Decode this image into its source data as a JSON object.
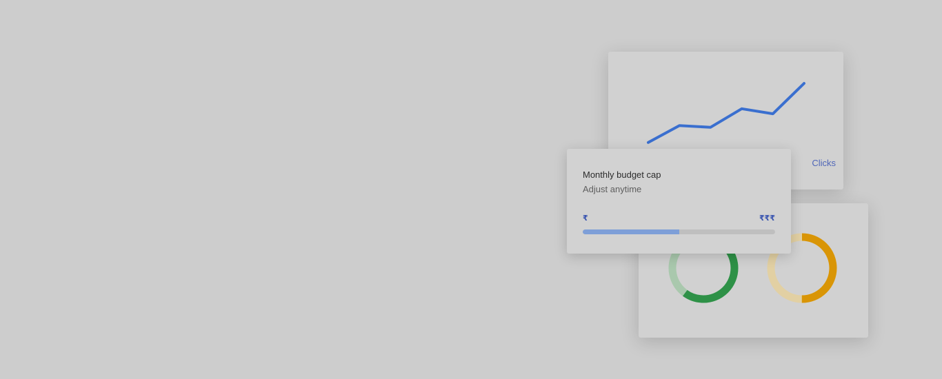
{
  "chart_card": {
    "series_label": "Clicks",
    "line_color": "#3a6fcf",
    "chart_data": {
      "type": "line",
      "series": [
        {
          "values": [
            1,
            3,
            2.8,
            5,
            4.4,
            8
          ]
        }
      ]
    }
  },
  "budget_card": {
    "title": "Monthly budget cap",
    "subtitle": "Adjust anytime",
    "range_min": "₹",
    "range_max": "₹₹₹",
    "level_fraction": 0.5,
    "fill_color": "#7e9fd8"
  },
  "donut_card": {
    "donuts": [
      {
        "color": "#2e9147",
        "light_color": "#a9c8ad",
        "fraction": 0.6
      },
      {
        "color": "#d99506",
        "light_color": "#e2d0a3",
        "fraction": 0.5
      }
    ]
  }
}
